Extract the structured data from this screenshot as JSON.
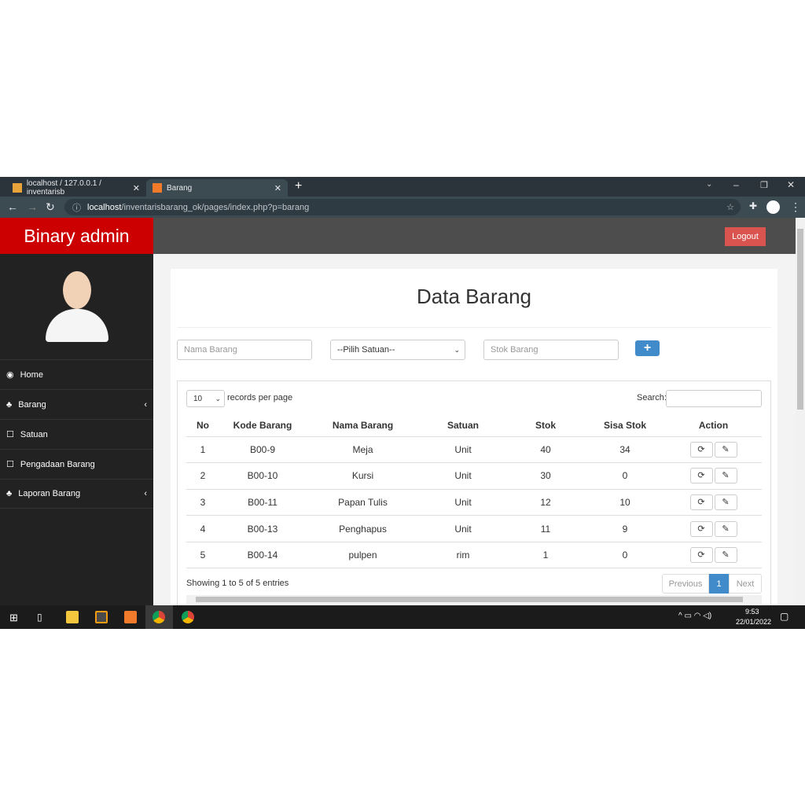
{
  "browser": {
    "tabs": [
      {
        "label": "localhost / 127.0.0.1 / inventarisb"
      },
      {
        "label": "Barang"
      }
    ],
    "url_host": "localhost",
    "url_path": "/inventarisbarang_ok/pages/index.php?p=barang"
  },
  "app": {
    "brand": "Binary admin",
    "logout": "Logout"
  },
  "sidebar": {
    "items": [
      {
        "label": "Home",
        "icon": "dashboard-icon"
      },
      {
        "label": "Barang",
        "icon": "sitemap-icon"
      },
      {
        "label": "Satuan",
        "icon": "square-icon"
      },
      {
        "label": "Pengadaan Barang",
        "icon": "square-icon"
      },
      {
        "label": "Laporan Barang",
        "icon": "sitemap-icon"
      }
    ]
  },
  "page": {
    "title": "Data Barang",
    "form": {
      "nama_placeholder": "Nama Barang",
      "satuan_selected": "--Pilih Satuan--",
      "stok_placeholder": "Stok Barang"
    },
    "table_controls": {
      "per_page": "10",
      "per_page_label": "records per page",
      "search_label": "Search:"
    },
    "columns": [
      "No",
      "Kode Barang",
      "Nama Barang",
      "Satuan",
      "Stok",
      "Sisa Stok",
      "Action"
    ],
    "rows": [
      [
        "1",
        "B00-9",
        "Meja",
        "Unit",
        "40",
        "34"
      ],
      [
        "2",
        "B00-10",
        "Kursi",
        "Unit",
        "30",
        "0"
      ],
      [
        "3",
        "B00-11",
        "Papan Tulis",
        "Unit",
        "12",
        "10"
      ],
      [
        "4",
        "B00-13",
        "Penghapus",
        "Unit",
        "11",
        "9"
      ],
      [
        "5",
        "B00-14",
        "pulpen",
        "rim",
        "1",
        "0"
      ]
    ],
    "info": "Showing 1 to 5 of 5 entries",
    "pagination": {
      "prev": "Previous",
      "current": "1",
      "next": "Next"
    }
  },
  "taskbar": {
    "time": "9:53",
    "date": "22/01/2022"
  },
  "colors": {
    "brand": "#cc0000",
    "logout": "#d9534f",
    "primary": "#428bca"
  }
}
